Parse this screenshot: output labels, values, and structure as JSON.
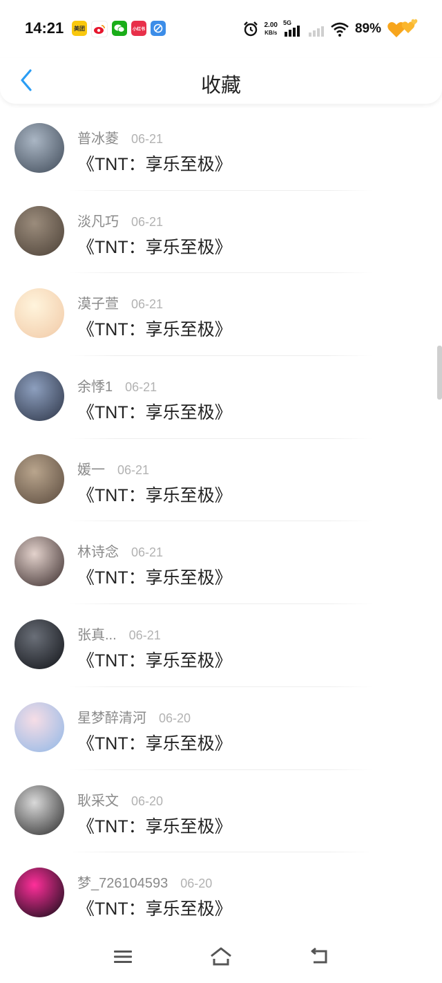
{
  "status_bar": {
    "time": "14:21",
    "notification_icons": [
      {
        "name": "meituan-icon",
        "label": "美团",
        "color": "#f9c80e"
      },
      {
        "name": "weibo-icon",
        "label": "",
        "color": "#ffffff"
      },
      {
        "name": "wechat-icon",
        "label": "",
        "color": "#1aad19"
      },
      {
        "name": "xiaohongshu-icon",
        "label": "小红书",
        "color": "#e8304a"
      },
      {
        "name": "browser-icon",
        "label": "",
        "color": "#3c8de8"
      }
    ],
    "net_speed_value": "2.00",
    "net_speed_unit": "KB/s",
    "signal_label": "5G",
    "battery": "89%"
  },
  "header": {
    "title": "收藏"
  },
  "items": [
    {
      "user": "普冰菱",
      "date": "06-21",
      "title": "《TNT：享乐至极》",
      "avatar_colors": [
        "#aab6c4",
        "#3f4a58"
      ]
    },
    {
      "user": "淡凡巧",
      "date": "06-21",
      "title": "《TNT：享乐至极》",
      "avatar_colors": [
        "#9b8c7c",
        "#4b4036"
      ]
    },
    {
      "user": "漠子萱",
      "date": "06-21",
      "title": "《TNT：享乐至极》",
      "avatar_colors": [
        "#fff4dc",
        "#f1c9a6"
      ]
    },
    {
      "user": "余悸1",
      "date": "06-21",
      "title": "《TNT：享乐至极》",
      "avatar_colors": [
        "#8d9fbe",
        "#2c3446"
      ]
    },
    {
      "user": "媛一",
      "date": "06-21",
      "title": "《TNT：享乐至极》",
      "avatar_colors": [
        "#b9a58d",
        "#5a4a3d"
      ]
    },
    {
      "user": "林诗念",
      "date": "06-21",
      "title": "《TNT：享乐至极》",
      "avatar_colors": [
        "#e3d2cc",
        "#3a2c2c"
      ]
    },
    {
      "user": "张真...",
      "date": "06-21",
      "title": "《TNT：享乐至极》",
      "avatar_colors": [
        "#6a6f78",
        "#111318"
      ]
    },
    {
      "user": "星梦醉清河",
      "date": "06-20",
      "title": "《TNT：享乐至极》",
      "avatar_colors": [
        "#f6dde6",
        "#8fb7e6"
      ]
    },
    {
      "user": "耿采文",
      "date": "06-20",
      "title": "《TNT：享乐至极》",
      "avatar_colors": [
        "#d9d9d9",
        "#2a2a2a"
      ]
    },
    {
      "user": "梦_726104593",
      "date": "06-20",
      "title": "《TNT：享乐至极》",
      "avatar_colors": [
        "#ff2f9a",
        "#0c0c14"
      ]
    }
  ],
  "colors": {
    "accent": "#2a9df4",
    "title_text": "#222222",
    "meta_text": "#8a8a8a"
  }
}
